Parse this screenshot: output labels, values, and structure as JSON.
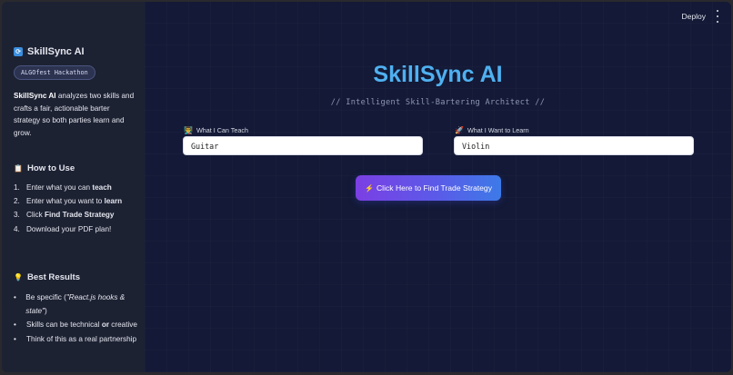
{
  "header": {
    "deploy_label": "Deploy",
    "menu_icon": "kebab-menu-icon"
  },
  "sidebar": {
    "app_icon": "sync-icon",
    "app_title": "SkillSync AI",
    "badge": "ALGOfest Hackathon",
    "description_bold": "SkillSync AI",
    "description_rest": " analyzes two skills and crafts a fair, actionable barter strategy so both parties learn and grow.",
    "how_to_icon": "clipboard-icon",
    "how_to_title": "How to Use",
    "how_to_steps": [
      {
        "num": "1.",
        "pre": "Enter what you can ",
        "bold": "teach",
        "post": ""
      },
      {
        "num": "2.",
        "pre": "Enter what you want to ",
        "bold": "learn",
        "post": ""
      },
      {
        "num": "3.",
        "pre": "Click ",
        "bold": "Find Trade Strategy",
        "post": ""
      },
      {
        "num": "4.",
        "pre": "Download your PDF plan!",
        "bold": "",
        "post": ""
      }
    ],
    "best_icon": "lightbulb-icon",
    "best_title": "Best Results",
    "best_items": [
      {
        "pre": "Be specific (",
        "italic": "\"React.js hooks & state\"",
        "post": ")"
      },
      {
        "pre": "Skills can be technical ",
        "bold": "or",
        "post": " creative"
      },
      {
        "pre": "Think of this as a real partnership"
      }
    ]
  },
  "main": {
    "title": "SkillSync AI",
    "subtitle": "// Intelligent Skill-Bartering Architect //",
    "teach_label": "What I Can Teach",
    "teach_icon": "teacher-icon",
    "teach_value": "Guitar",
    "learn_label": "What I Want to Learn",
    "learn_icon": "rocket-icon",
    "learn_value": "Violin",
    "cta_label": "Click Here to Find Trade Strategy",
    "cta_icon": "lightning-icon"
  },
  "colors": {
    "accent_title": "#4fb0f0",
    "cta_start": "#7b3fe4",
    "cta_end": "#3d7ae8",
    "sidebar_bg": "#1d2233",
    "main_bg": "#131936"
  }
}
